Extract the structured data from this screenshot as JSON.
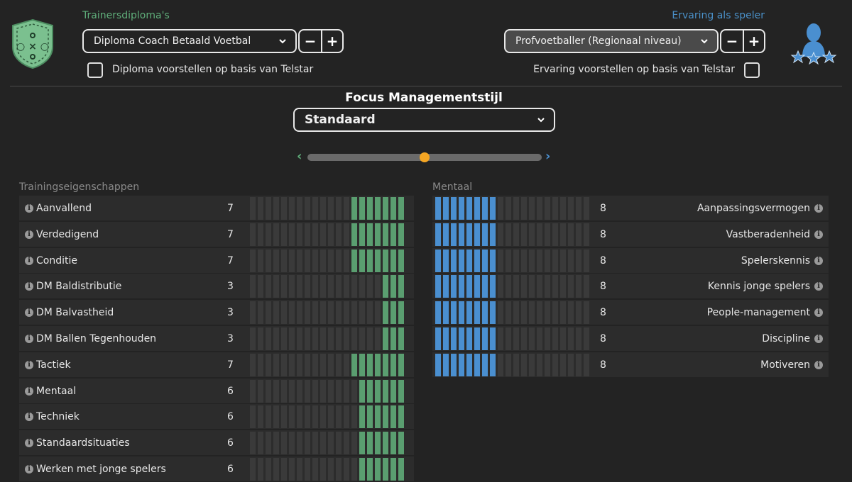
{
  "header": {
    "trainer_diplomas_label": "Trainersdiploma's",
    "diploma_select": "Diploma Coach Betaald Voetbal",
    "diploma_suggest_label": "Diploma voorstellen op basis van Telstar",
    "player_experience_label": "Ervaring als speler",
    "experience_select": "Profvoetballer (Regionaal niveau)",
    "experience_suggest_label": "Ervaring voorstellen op basis van Telstar",
    "minus_label": "−",
    "plus_label": "+"
  },
  "focus": {
    "title": "Focus Managementstijl",
    "select": "Standaard",
    "slider_left": "‹",
    "slider_right": "›",
    "slider_value": 0.5
  },
  "training": {
    "title": "Trainingseigenschappen",
    "max": 20,
    "items": [
      {
        "label": "Aanvallend",
        "value": "7"
      },
      {
        "label": "Verdedigend",
        "value": "7"
      },
      {
        "label": "Conditie",
        "value": "7"
      },
      {
        "label": "DM Baldistributie",
        "value": "3"
      },
      {
        "label": "DM Balvastheid",
        "value": "3"
      },
      {
        "label": "DM Ballen Tegenhouden",
        "value": "3"
      },
      {
        "label": "Tactiek",
        "value": "7"
      },
      {
        "label": "Mentaal",
        "value": "6"
      },
      {
        "label": "Techniek",
        "value": "6"
      },
      {
        "label": "Standaardsituaties",
        "value": "6"
      },
      {
        "label": "Werken met jonge spelers",
        "value": "6"
      }
    ]
  },
  "mental": {
    "title": "Mentaal",
    "max": 20,
    "items": [
      {
        "label": "Aanpassingsvermogen",
        "value": "8"
      },
      {
        "label": "Vastberadenheid",
        "value": "8"
      },
      {
        "label": "Spelerskennis",
        "value": "8"
      },
      {
        "label": "Kennis jonge spelers",
        "value": "8"
      },
      {
        "label": "People-management",
        "value": "8"
      },
      {
        "label": "Discipline",
        "value": "8"
      },
      {
        "label": "Motiveren",
        "value": "8"
      }
    ]
  },
  "info_glyph": "i",
  "colors": {
    "green_accent": "#5a9e70",
    "blue_accent": "#4a8fd0",
    "slider_knob": "#f5a623"
  }
}
